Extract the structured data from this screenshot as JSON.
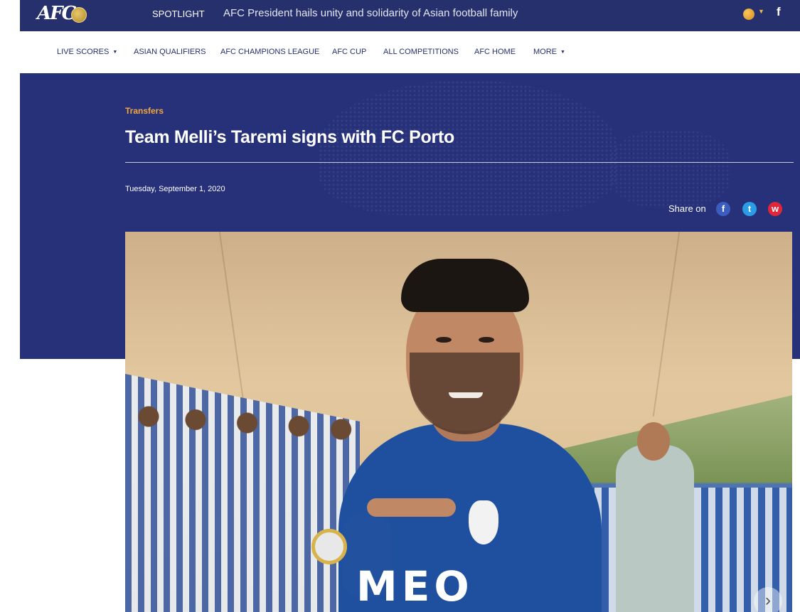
{
  "brand": {
    "logo_text": "AFC"
  },
  "topbar": {
    "spotlight_label": "SPOTLIGHT",
    "spotlight_headline": "AFC President hails unity and solidarity of Asian football family",
    "facebook_glyph": "f",
    "icons": [
      "football-icon",
      "facebook-icon"
    ]
  },
  "nav": {
    "items": [
      {
        "label": "LIVE SCORES",
        "has_caret": true
      },
      {
        "label": "ASIAN QUALIFIERS",
        "has_caret": false
      },
      {
        "label": "AFC CHAMPIONS LEAGUE",
        "has_caret": false
      },
      {
        "label": "AFC CUP",
        "has_caret": false
      },
      {
        "label": "ALL COMPETITIONS",
        "has_caret": false
      },
      {
        "label": "AFC HOME",
        "has_caret": false
      },
      {
        "label": "MORE",
        "has_caret": true
      }
    ],
    "caret_glyph": "▼"
  },
  "article": {
    "category": "Transfers",
    "title": "Team Melli’s Taremi signs with FC Porto",
    "date": "Tuesday, September 1, 2020",
    "share_label": "Share on",
    "share_icons": [
      {
        "name": "facebook-share-icon",
        "glyph": "f"
      },
      {
        "name": "twitter-share-icon",
        "glyph": "t"
      },
      {
        "name": "weibo-share-icon",
        "glyph": "w"
      }
    ],
    "photo_sponsor_text": "MEO",
    "next_glyph": "›"
  },
  "colors": {
    "topbar_bg": "#25306d",
    "hero_bg": "#26317a",
    "nav_text": "#24306b",
    "category_accent": "#f0a63d",
    "facebook": "#3b5dbe",
    "twitter": "#2a9de6",
    "weibo": "#e0263a"
  }
}
